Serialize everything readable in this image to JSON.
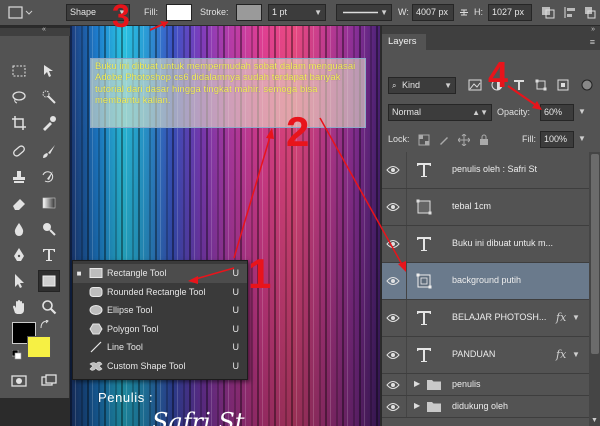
{
  "options_bar": {
    "mode": "Shape",
    "fill_label": "Fill:",
    "stroke_label": "Stroke:",
    "stroke_width": "1 pt",
    "w_label": "W:",
    "w_value": "4007 px",
    "h_label": "H:",
    "h_value": "1027 px",
    "fill_color": "#ffffff",
    "stroke_color": "#9a9a9a"
  },
  "canvas": {
    "text_block": "Buku ini dibuat untuk mempermudah sobat dalam menguasai Adobe Photoshop cs6 didalamnya sudah terdapat banyak tutorial dari dasar hingga tingkat mahir. semoga bisa membantu kalian.",
    "penulis_label": "Penulis :",
    "penulis_name": "Safri St"
  },
  "flyout": {
    "items": [
      {
        "label": "Rectangle Tool",
        "key": "U",
        "icon": "rectangle-icon",
        "selected": true
      },
      {
        "label": "Rounded Rectangle Tool",
        "key": "U",
        "icon": "rounded-rectangle-icon",
        "selected": false
      },
      {
        "label": "Ellipse Tool",
        "key": "U",
        "icon": "ellipse-icon",
        "selected": false
      },
      {
        "label": "Polygon Tool",
        "key": "U",
        "icon": "polygon-icon",
        "selected": false
      },
      {
        "label": "Line Tool",
        "key": "U",
        "icon": "line-icon",
        "selected": false
      },
      {
        "label": "Custom Shape Tool",
        "key": "U",
        "icon": "custom-shape-icon",
        "selected": false
      }
    ]
  },
  "layers_panel": {
    "tab": "Layers",
    "filter_kind": "Kind",
    "blend_mode": "Normal",
    "opacity_label": "Opacity:",
    "opacity_value": "60%",
    "lock_label": "Lock:",
    "fill_label": "Fill:",
    "fill_value": "100%",
    "layers": [
      {
        "name": "penulis oleh : Safri St",
        "type": "text",
        "fx": false,
        "selected": false
      },
      {
        "name": "tebal 1cm",
        "type": "shape",
        "fx": false,
        "selected": false
      },
      {
        "name": "Buku ini dibuat untuk m...",
        "type": "text",
        "fx": false,
        "selected": false
      },
      {
        "name": "background putih",
        "type": "shape",
        "fx": false,
        "selected": true
      },
      {
        "name": "BELAJAR PHOTOSH...",
        "type": "text",
        "fx": true,
        "selected": false
      },
      {
        "name": "PANDUAN",
        "type": "text",
        "fx": true,
        "selected": false
      }
    ],
    "groups": [
      {
        "name": "penulis"
      },
      {
        "name": "didukung oleh"
      }
    ]
  },
  "annotations": {
    "n1": "1",
    "n2": "2",
    "n3": "3",
    "n4": "4",
    "color": "#e8141b"
  }
}
